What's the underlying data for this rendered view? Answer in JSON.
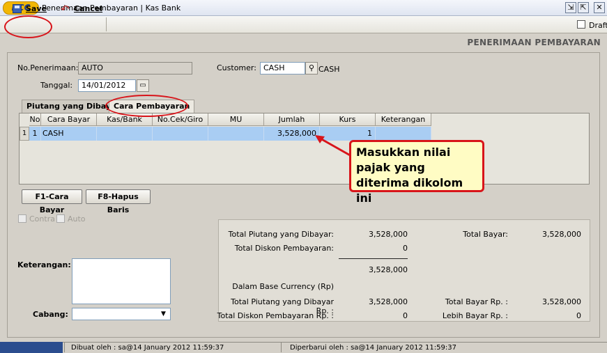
{
  "window": {
    "logo_text": "BCC",
    "title": "Penerimaan Pembayaran | Kas Bank",
    "buttons": {
      "restore": "⇱",
      "minimize": "⇲",
      "close": "✕"
    }
  },
  "toolbar": {
    "save_label": "Save",
    "cancel_label": "Cancel",
    "draft_label": "Draft",
    "draft_checked": false
  },
  "header": {
    "title": "PENERIMAAN PEMBAYARAN"
  },
  "form": {
    "no_penerimaan_label": "No.Penerimaan:",
    "no_penerimaan_value": "AUTO",
    "tanggal_label": "Tanggal:",
    "tanggal_value": "14/01/2012",
    "customer_label": "Customer:",
    "customer_value": "CASH",
    "customer_name": "CASH"
  },
  "tabs": [
    {
      "label": "Piutang yang Dibayar",
      "active": false
    },
    {
      "label": "Cara Pembayaran",
      "active": true
    }
  ],
  "grid": {
    "columns": [
      "No",
      "Cara Bayar",
      "Kas/Bank",
      "No.Cek/Giro",
      "MU",
      "Jumlah",
      "Kurs",
      "Keterangan"
    ],
    "rows": [
      {
        "row_index": "1",
        "no": "1",
        "cara_bayar": "CASH",
        "kas_bank": "",
        "no_cek": "",
        "mu": "",
        "jumlah": "3,528,000",
        "kurs": "1",
        "keterangan": ""
      }
    ]
  },
  "grid_buttons": {
    "f1": "F1-Cara Bayar",
    "f8": "F8-Hapus Baris"
  },
  "options": {
    "contra_label": "Contra",
    "auto_label": "Auto"
  },
  "bottom": {
    "keterangan_label": "Keterangan:",
    "cabang_label": "Cabang:",
    "cabang_value": ""
  },
  "totals": {
    "total_piutang_label": "Total Piutang yang Dibayar:",
    "total_piutang_value": "3,528,000",
    "total_diskon_label": "Total Diskon Pembayaran:",
    "total_diskon_value": "0",
    "subtotal_value": "3,528,000",
    "base_currency_label": "Dalam Base Currency (Rp)",
    "total_piutang_rp_label": "Total Piutang yang Dibayar Rp. :",
    "total_piutang_rp_value": "3,528,000",
    "total_diskon_rp_label": "Total Diskon Pembayaran Rp. :",
    "total_diskon_rp_value": "0",
    "total_bayar_label": "Total Bayar:",
    "total_bayar_value": "3,528,000",
    "total_bayar_rp_label": "Total Bayar Rp. :",
    "total_bayar_rp_value": "3,528,000",
    "lebih_bayar_rp_label": "Lebih Bayar Rp. :",
    "lebih_bayar_rp_value": "0"
  },
  "status": {
    "created": "Dibuat oleh :  sa@14 January 2012   11:59:37",
    "updated": "Diperbarui oleh :  sa@14 January 2012   11:59:37"
  },
  "annotation": {
    "callout_text": "Masukkan nilai pajak yang diterima dikolom ini"
  },
  "colors": {
    "annotation_red": "#d8141a",
    "callout_bg": "#fffcc4",
    "row_selected": "#a9cdf3"
  }
}
